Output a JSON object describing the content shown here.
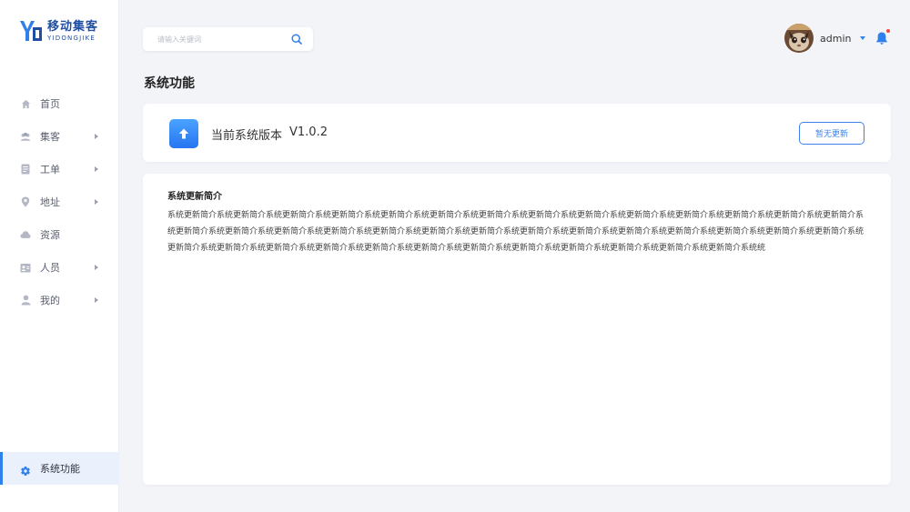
{
  "brand": {
    "title": "移动集客",
    "subtitle": "YIDONGJIKE",
    "accent": "#2f80ed"
  },
  "sidebar": {
    "items": [
      {
        "label": "首页",
        "icon": "home-icon",
        "has_arrow": false
      },
      {
        "label": "集客",
        "icon": "users-icon",
        "has_arrow": true
      },
      {
        "label": "工单",
        "icon": "document-icon",
        "has_arrow": true
      },
      {
        "label": "地址",
        "icon": "location-pin-icon",
        "has_arrow": true
      },
      {
        "label": "资源",
        "icon": "cloud-icon",
        "has_arrow": false
      },
      {
        "label": "人员",
        "icon": "id-card-icon",
        "has_arrow": true
      },
      {
        "label": "我的",
        "icon": "user-icon",
        "has_arrow": true
      }
    ],
    "active_item": {
      "label": "系统功能",
      "icon": "gear-icon"
    }
  },
  "search": {
    "placeholder": "请输入关键词",
    "value": ""
  },
  "user": {
    "name": "admin"
  },
  "page_title": "系统功能",
  "version": {
    "label": "当前系统版本",
    "number": "V1.0.2",
    "button_label": "暂无更新"
  },
  "description": {
    "title": "系统更新简介",
    "body": "系统更新简介系统更新简介系统更新简介系统更新简介系统更新简介系统更新简介系统更新简介系统更新简介系统更新简介系统更新简介系统更新简介系统更新简介系统更新简介系统更新简介系统更新简介系统更新简介系统更新简介系统更新简介系统更新简介系统更新简介系统更新简介系统更新简介系统更新简介系统更新简介系统更新简介系统更新简介系统更新简介系统更新简介系统更新简介系统更新简介系统更新简介系统更新简介系统更新简介系统更新简介系统更新简介系统更新简介系统更新简介系统更新简介系统更新简介系统更新简介系统统"
  }
}
